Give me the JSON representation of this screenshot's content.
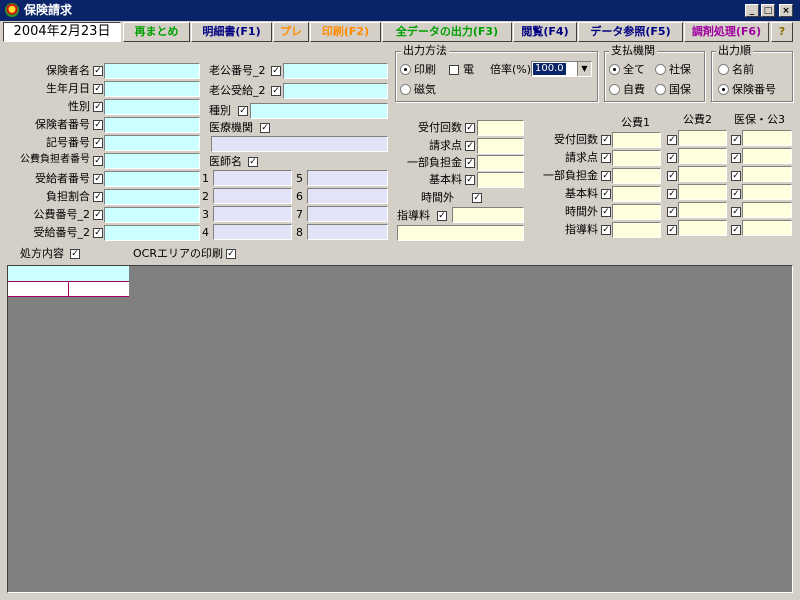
{
  "window": {
    "title": "保険請求"
  },
  "toolbar": {
    "date": "2004年2月23日",
    "buttons": [
      {
        "label": "再まとめ",
        "color": "#00a000"
      },
      {
        "label": "明細書(F1)",
        "color": "#000080"
      },
      {
        "label": "プレ",
        "color": "#ff8c00"
      },
      {
        "label": "印刷(F2)",
        "color": "#ff8c00"
      },
      {
        "label": "全データの出力(F3)",
        "color": "#00a000"
      },
      {
        "label": "閲覧(F4)",
        "color": "#000080"
      },
      {
        "label": "データ参照(F5)",
        "color": "#000080"
      },
      {
        "label": "調剤処理(F6)",
        "color": "#a000a0"
      },
      {
        "label": "?",
        "icon": "help-icon"
      }
    ]
  },
  "left_fields": [
    "保険者名",
    "生年月日",
    "性別",
    "保険者番号",
    "記号番号",
    "公費負担者番号",
    "受給者番号",
    "負担割合",
    "公費番号_2",
    "受給番号_2"
  ],
  "mid_fields": {
    "rokou_bangou": "老公番号_2",
    "rokou_jukyu": "老公受給_2",
    "shubetsu": "種別",
    "iryou_kikan": "医療機関",
    "ishi_mei": "医師名",
    "doctor_numbers": [
      "1",
      "2",
      "3",
      "4",
      "5",
      "6",
      "7",
      "8"
    ]
  },
  "output_method": {
    "title": "出力方法",
    "print": "印刷",
    "den": "電",
    "magnetic": "磁気",
    "ratio_label": "倍率(%)",
    "ratio_value": "100.0",
    "selected": "印刷"
  },
  "payer": {
    "title": "支払機関",
    "options": [
      "全て",
      "社保",
      "自費",
      "国保"
    ],
    "selected": "全て"
  },
  "order": {
    "title": "出力順",
    "options": [
      "名前",
      "保険番号"
    ],
    "selected": "保険番号"
  },
  "center_counts": [
    "受付回数",
    "請求点",
    "一部負担金",
    "基本料"
  ],
  "time_extra": "時間外",
  "guidance": "指導料",
  "public_table": {
    "columns": [
      "公費1",
      "公費2",
      "医保・公3"
    ],
    "rows": [
      "受付回数",
      "請求点",
      "一部負担金",
      "基本料",
      "時間外",
      "指導料"
    ]
  },
  "bottom": {
    "prescription": "処方内容",
    "ocr_print": "OCRエリアの印刷"
  }
}
